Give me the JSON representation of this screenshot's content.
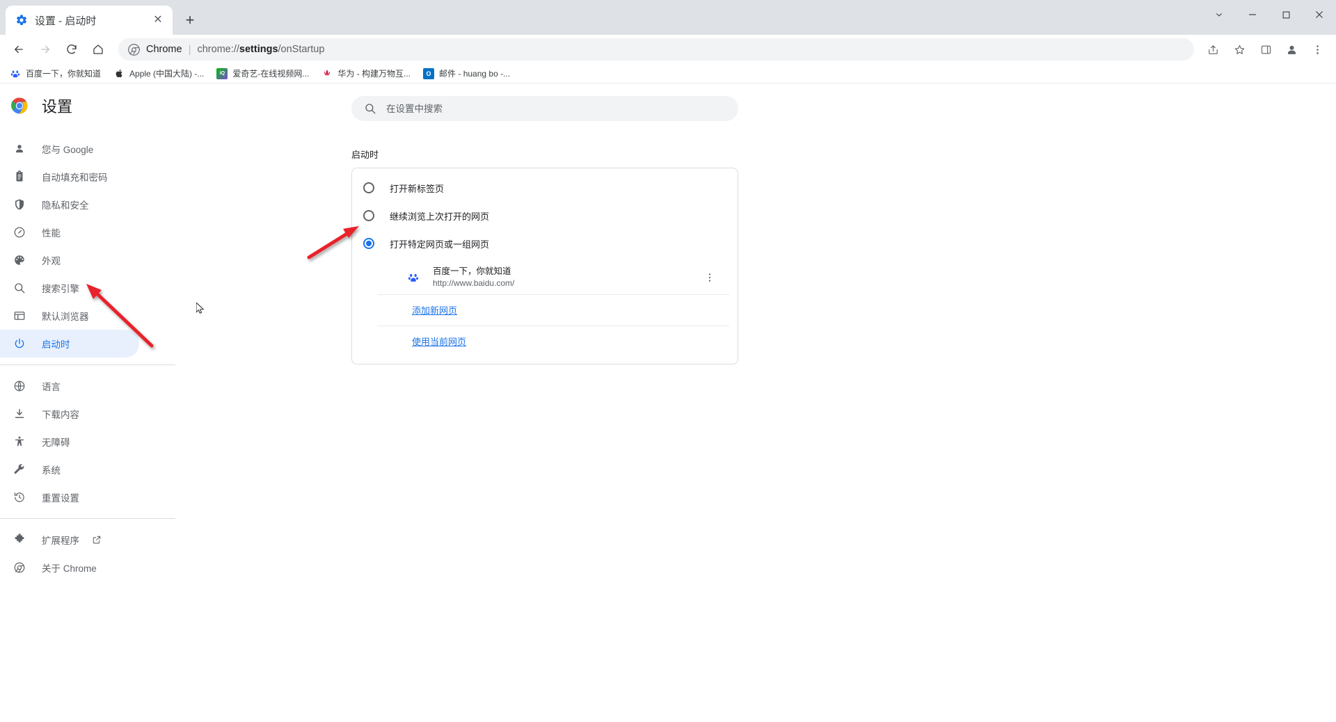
{
  "window": {
    "controls": [
      {
        "name": "more-chevron",
        "glyph": "⌄"
      },
      {
        "name": "minimize",
        "glyph": "—"
      },
      {
        "name": "maximize",
        "glyph": "▢"
      },
      {
        "name": "close",
        "glyph": "✕"
      }
    ]
  },
  "tab": {
    "title": "设置 - 启动时",
    "favicon": "settings-gear-icon",
    "close_glyph": "✕",
    "newtab_glyph": "+"
  },
  "toolbar": {
    "back_glyph": "←",
    "forward_glyph": "→",
    "reload_glyph": "⟳",
    "home_glyph": "⌂",
    "omnibox": {
      "scheme_label": "Chrome",
      "separator": "|",
      "url_prefix": "chrome://",
      "url_bold": "settings",
      "url_suffix": "/onStartup",
      "full_url": "chrome://settings/onStartup"
    },
    "share_glyph": "⇪",
    "bookmark_star_glyph": "☆",
    "sidepanel_glyph": "▥",
    "profile_glyph": "●",
    "menu_glyph": "⋮"
  },
  "bookmarks": [
    {
      "label": "百度一下，你就知道",
      "icon": "baidu-paw-icon",
      "color": "#2b5cff"
    },
    {
      "label": "Apple (中国大陆) -...",
      "icon": "apple-logo-icon",
      "color": "#333333"
    },
    {
      "label": "爱奇艺-在线视频网...",
      "icon": "iqiyi-icon",
      "color": "#00be06"
    },
    {
      "label": "华为 - 构建万物互...",
      "icon": "huawei-flower-icon",
      "color": "#cf0a2c"
    },
    {
      "label": "邮件 - huang bo -...",
      "icon": "outlook-icon",
      "color": "#0072c6"
    }
  ],
  "settings": {
    "brand_title": "设置",
    "brand_icon": "chrome-logo-icon",
    "search": {
      "placeholder": "在设置中搜索",
      "value": "",
      "icon": "search-icon"
    },
    "nav": {
      "groups": [
        {
          "items": [
            {
              "label": "您与 Google",
              "icon": "person-icon",
              "active": false
            },
            {
              "label": "自动填充和密码",
              "icon": "clipboard-icon",
              "active": false
            },
            {
              "label": "隐私和安全",
              "icon": "shield-icon",
              "active": false
            },
            {
              "label": "性能",
              "icon": "speedometer-icon",
              "active": false
            },
            {
              "label": "外观",
              "icon": "palette-icon",
              "active": false
            },
            {
              "label": "搜索引擎",
              "icon": "search-icon",
              "active": false
            },
            {
              "label": "默认浏览器",
              "icon": "browser-window-icon",
              "active": false
            },
            {
              "label": "启动时",
              "icon": "power-icon",
              "active": true
            }
          ]
        },
        {
          "items": [
            {
              "label": "语言",
              "icon": "globe-icon",
              "active": false
            },
            {
              "label": "下载内容",
              "icon": "download-icon",
              "active": false
            },
            {
              "label": "无障碍",
              "icon": "accessibility-icon",
              "active": false
            },
            {
              "label": "系统",
              "icon": "wrench-icon",
              "active": false
            },
            {
              "label": "重置设置",
              "icon": "history-restore-icon",
              "active": false
            }
          ]
        },
        {
          "items": [
            {
              "label": "扩展程序",
              "icon": "puzzle-icon",
              "active": false,
              "external": true,
              "external_icon": "external-link-icon"
            },
            {
              "label": "关于 Chrome",
              "icon": "chrome-outline-icon",
              "active": false
            }
          ]
        }
      ]
    },
    "startup": {
      "section_title": "启动时",
      "options": [
        {
          "label": "打开新标签页",
          "checked": false
        },
        {
          "label": "继续浏览上次打开的网页",
          "checked": false
        },
        {
          "label": "打开特定网页或一组网页",
          "checked": true
        }
      ],
      "sites": [
        {
          "name": "百度一下，你就知道",
          "url": "http://www.baidu.com/",
          "favicon": "baidu-paw-icon",
          "menu_glyph": "⋮"
        }
      ],
      "add_page_link": "添加新网页",
      "use_current_pages_link": "使用当前网页"
    }
  },
  "colors": {
    "accent": "#1a73e8",
    "active_pill": "#e8f0fe",
    "annotation_arrow": "#e8202a",
    "tabstrip": "#dee1e6"
  }
}
